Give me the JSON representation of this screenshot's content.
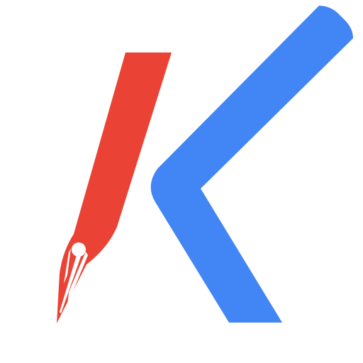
{
  "logo": {
    "name": "K pen-nib logo",
    "colors": {
      "background": "#ffffff",
      "pen": "#EA4335",
      "chevron": "#4285F4",
      "nib_highlight": "#ffffff"
    },
    "icons": {
      "pen": "pen-nib-icon",
      "chevron": "k-chevron-shape"
    }
  }
}
